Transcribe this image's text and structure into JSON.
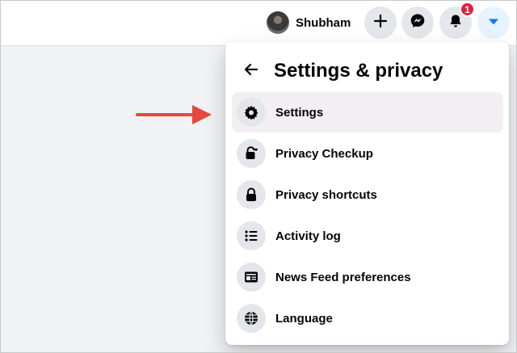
{
  "header": {
    "profile_name": "Shubham",
    "notification_count": "1",
    "buttons": [
      "create-icon",
      "messenger-icon",
      "bell-icon",
      "caret-down-icon"
    ]
  },
  "panel": {
    "title": "Settings & privacy",
    "items": [
      {
        "label": "Settings",
        "icon": "gear-icon",
        "highlighted": true
      },
      {
        "label": "Privacy Checkup",
        "icon": "lock-heart-icon"
      },
      {
        "label": "Privacy shortcuts",
        "icon": "lock-icon"
      },
      {
        "label": "Activity log",
        "icon": "list-icon"
      },
      {
        "label": "News Feed preferences",
        "icon": "news-feed-icon"
      },
      {
        "label": "Language",
        "icon": "globe-icon"
      }
    ]
  },
  "colors": {
    "accent": "#1877f2",
    "badge": "#e41e3f",
    "annotation_arrow": "#e8473f",
    "highlight": "#f2eef2"
  }
}
